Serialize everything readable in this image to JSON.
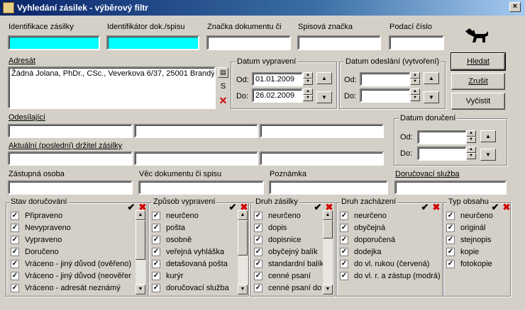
{
  "window": {
    "title": "Vyhledání zásilek - výběrový filtr",
    "close": "×"
  },
  "fields": {
    "identifikace_label": "Identifikace zásilky",
    "identifikator_label": "Identifikátor dok./spisu",
    "znacka_label": "Značka dokumentu či",
    "spisova_label": "Spisová značka",
    "podaci_label": "Podací číslo",
    "adresat_label": "Adresát",
    "adresat_value": "Žádná Jolana, PhDr., CSc., Veverkova 6/37, 25001 Brandý",
    "odesilajici_label": "Odesílající",
    "aktualni_label": "Aktuální (poslední) držitel zásilky",
    "zastupna_label": "Zástupná osoba",
    "vec_label": "Věc dokumentu či spisu",
    "poznamka_label": "Poznámka",
    "dorucovaci_label": "Doručovací služba"
  },
  "dates": {
    "vypraveni": {
      "title": "Datum vypravení",
      "od_label": "Od:",
      "do_label": "Do:",
      "od": "01.01.2009",
      "do": "26.02.2009"
    },
    "odeslani": {
      "title": "Datum odeslání (vytvoření)",
      "od_label": "Od:",
      "do_label": "Do:",
      "od": "",
      "do": ""
    },
    "doruceni": {
      "title": "Datum doručení",
      "od_label": "Od:",
      "do_label": "Do:",
      "od": "",
      "do": ""
    }
  },
  "buttons": {
    "hledat": "Hledat",
    "zrusit": "Zrušit",
    "vycistit": "Vyčistit",
    "s": "S"
  },
  "lists": {
    "stav": {
      "title": "Stav doručování",
      "items": [
        "Připraveno",
        "Nevypraveno",
        "Vypraveno",
        "Doručeno",
        "Vráceno - jiný důvod (ověřeno)",
        "Vráceno - jiný důvod (neověřeno)",
        "Vráceno - adresát neznámý"
      ]
    },
    "zpusob": {
      "title": "Způsob vypravení",
      "items": [
        "neurčeno",
        "pošta",
        "osobně",
        "veřejná vyhláška",
        "detašovaná pošta",
        "kurýr",
        "doručovací služba"
      ]
    },
    "druh_zasilky": {
      "title": "Druh zásilky",
      "items": [
        "neurčeno",
        "dopis",
        "dopisnice",
        "obyčejný balík",
        "standardní balík",
        "cenné psaní",
        "cenné psaní do"
      ]
    },
    "druh_zachazeni": {
      "title": "Druh zacházení",
      "items": [
        "neurčeno",
        "obyčejná",
        "doporučená",
        "dodejka",
        "do vl. rukou (červená)",
        "do vl. r. a zástup (modrá)"
      ]
    },
    "typ_obsahu": {
      "title": "Typ obsahu",
      "items": [
        "neurčeno",
        "originál",
        "stejnopis",
        "kopie",
        "fotokopie"
      ]
    }
  }
}
